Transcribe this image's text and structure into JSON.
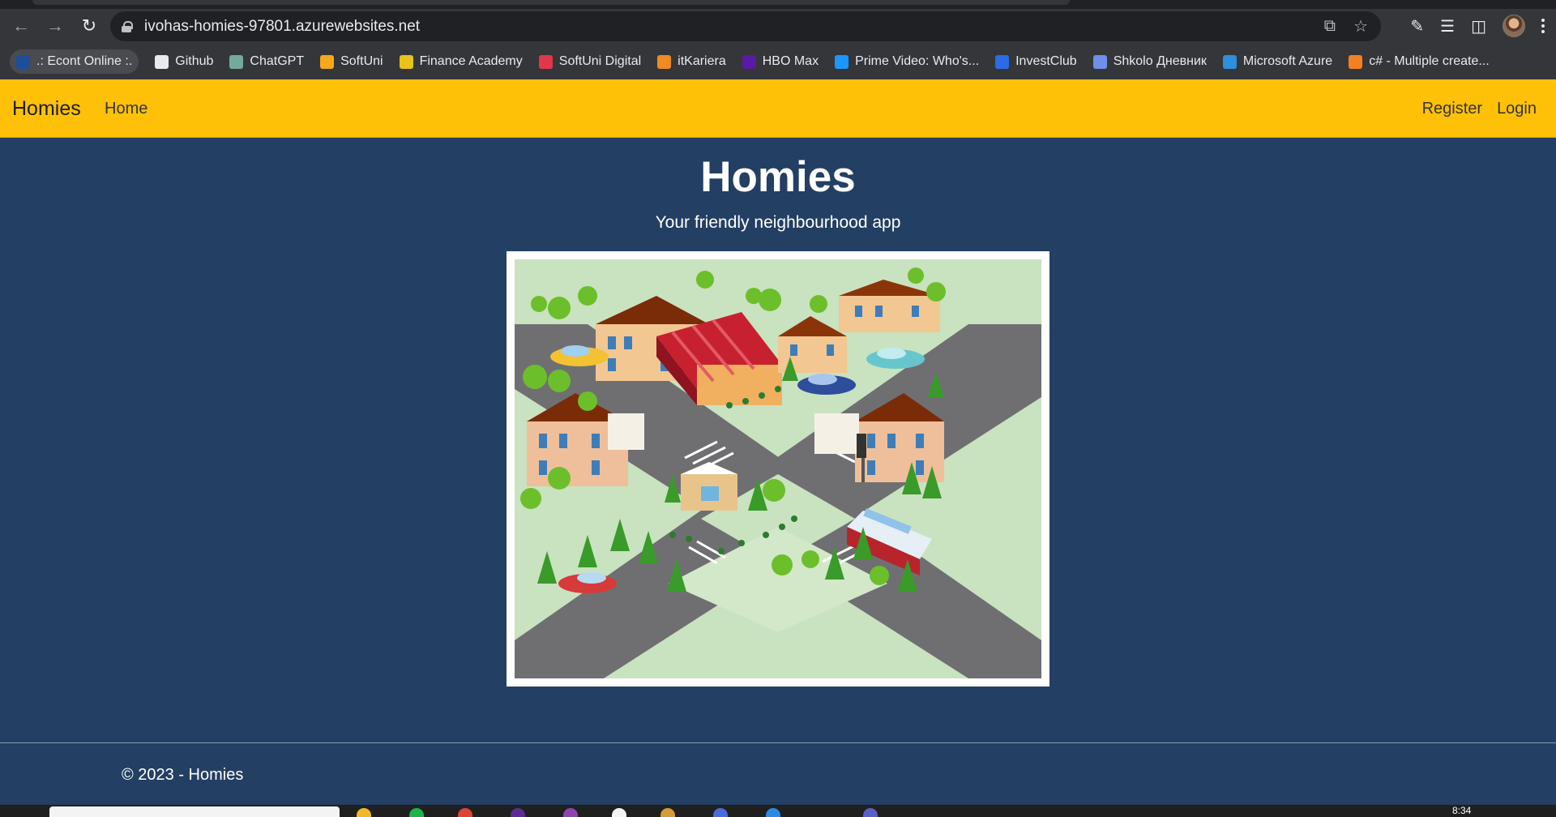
{
  "browser": {
    "url": "ivohas-homies-97801.azurewebsites.net",
    "bookmarks": [
      {
        "label": ".: Econt Online :.",
        "icon": "econt-icon",
        "color": "#1c4e9a"
      },
      {
        "label": "Github",
        "icon": "github-icon",
        "color": "#e8eaed"
      },
      {
        "label": "ChatGPT",
        "icon": "chatgpt-icon",
        "color": "#74aa9c"
      },
      {
        "label": "SoftUni",
        "icon": "softuni-icon",
        "color": "#f7a81b"
      },
      {
        "label": "Finance Academy",
        "icon": "finance-academy-icon",
        "color": "#e8c31a"
      },
      {
        "label": "SoftUni Digital",
        "icon": "softuni-digital-icon",
        "color": "#e0384a"
      },
      {
        "label": "itKariera",
        "icon": "itkariera-icon",
        "color": "#f08a24"
      },
      {
        "label": "HBO Max",
        "icon": "hbo-max-icon",
        "color": "#5a1aa3"
      },
      {
        "label": "Prime Video: Who's...",
        "icon": "prime-video-icon",
        "color": "#1a98ff"
      },
      {
        "label": "InvestClub",
        "icon": "investclub-icon",
        "color": "#2b6be8"
      },
      {
        "label": "Shkolo Дневник",
        "icon": "shkolo-icon",
        "color": "#6f8fe8"
      },
      {
        "label": "Microsoft Azure",
        "icon": "azure-icon",
        "color": "#2f8ee0"
      },
      {
        "label": "c# - Multiple create...",
        "icon": "stackoverflow-icon",
        "color": "#f48024"
      }
    ]
  },
  "navbar": {
    "brand": "Homies",
    "home": "Home",
    "register": "Register",
    "login": "Login",
    "background": "#ffc107"
  },
  "hero": {
    "title": "Homies",
    "subtitle": "Your friendly neighbourhood app",
    "image_label": "isometric-neighbourhood-illustration"
  },
  "footer": {
    "text": "© 2023 - Homies"
  },
  "taskbar": {
    "clock": "8:34"
  },
  "colors": {
    "page_background": "#233f63",
    "navbar": "#ffc107",
    "text_light": "#ffffff"
  }
}
